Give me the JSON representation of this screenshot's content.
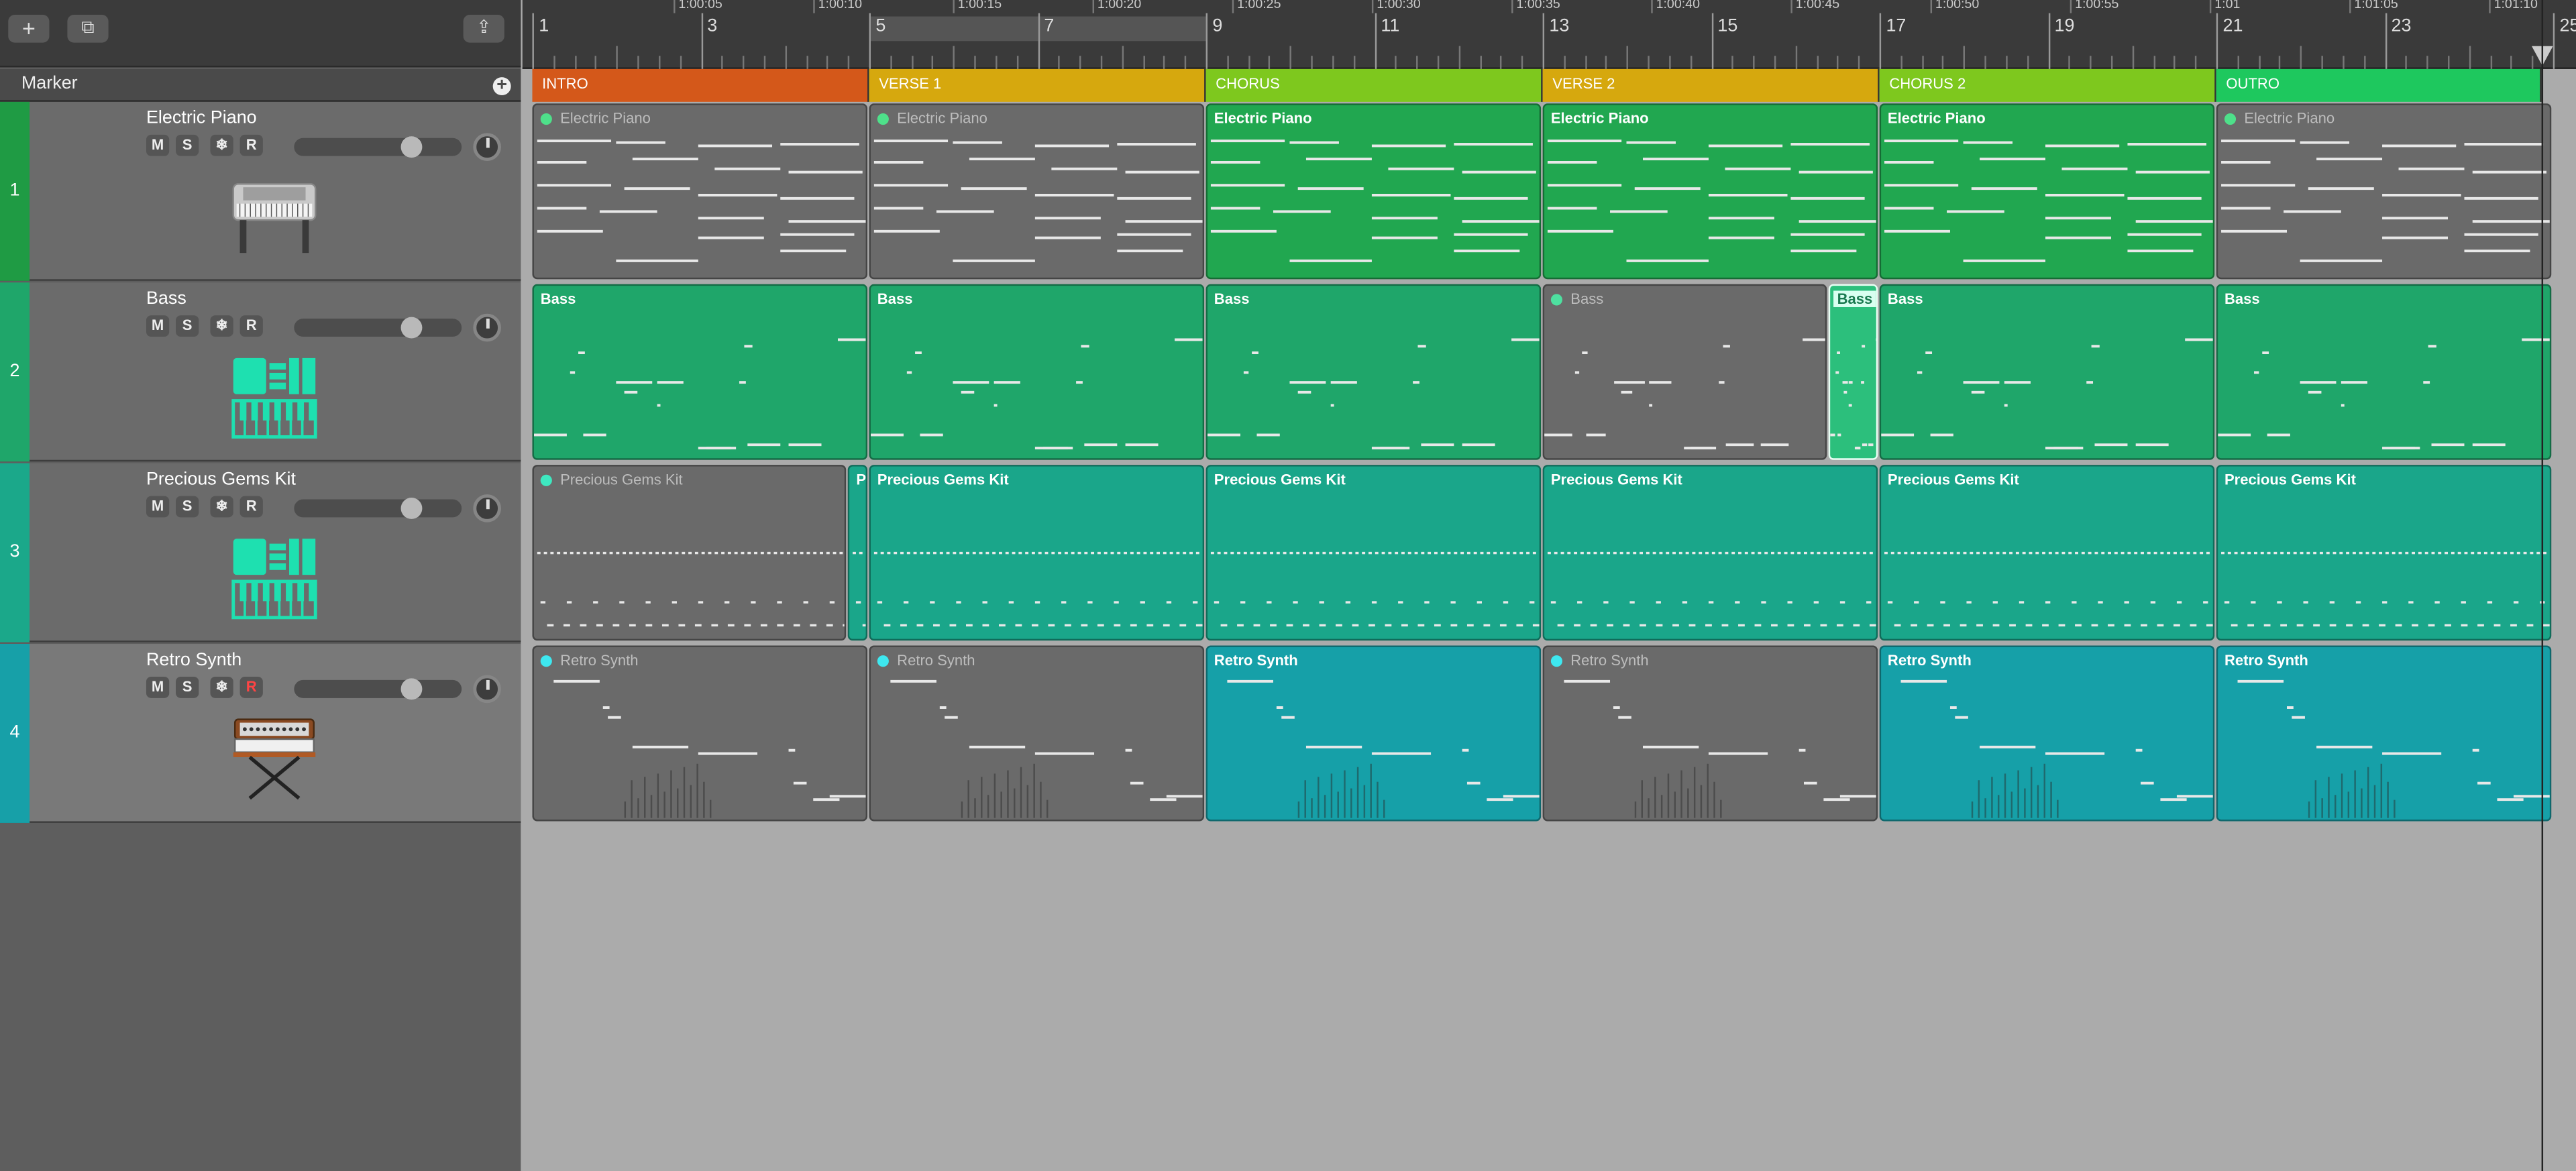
{
  "toolbar": {
    "add_label": "+",
    "dup_label": "⧉",
    "collapse_label": "⇪"
  },
  "marker_track": {
    "label": "Marker",
    "add": "+"
  },
  "ruler": {
    "bars": [
      "1",
      "3",
      "5",
      "7",
      "9",
      "11",
      "13",
      "15",
      "17",
      "19",
      "21",
      "23",
      "25"
    ],
    "times": [
      "1:00:05",
      "1:00:10",
      "1:00:15",
      "1:00:20",
      "1:00:25",
      "1:00:30",
      "1:00:35",
      "1:00:40",
      "1:00:45",
      "1:00:50",
      "1:00:55",
      "1:01",
      "1:01:05",
      "1:01:10"
    ]
  },
  "markers": [
    "INTRO",
    "VERSE 1",
    "CHORUS",
    "VERSE 2",
    "CHORUS 2",
    "OUTRO"
  ],
  "marker_colors": [
    "#d4581a",
    "#d6a80e",
    "#7ec81e",
    "#d6a80e",
    "#7ec81e",
    "#1ec85e"
  ],
  "tracks": [
    {
      "num": "1",
      "name": "Electric Piano",
      "mute": "M",
      "solo": "S",
      "freeze": "❄",
      "rec": "R",
      "color": "#1f9b44",
      "icon": "electric-piano-icon",
      "volume": 0.66
    },
    {
      "num": "2",
      "name": "Bass",
      "mute": "M",
      "solo": "S",
      "freeze": "❄",
      "rec": "R",
      "color": "#1fa66a",
      "icon": "drum-machine-icon",
      "volume": 0.66
    },
    {
      "num": "3",
      "name": "Precious Gems Kit",
      "mute": "M",
      "solo": "S",
      "freeze": "❄",
      "rec": "R",
      "color": "#1ba88a",
      "icon": "drum-machine-icon",
      "volume": 0.66
    },
    {
      "num": "4",
      "name": "Retro Synth",
      "mute": "M",
      "solo": "S",
      "freeze": "❄",
      "rec": "R",
      "color": "#17a0a8",
      "icon": "synthesizer-icon",
      "volume": 0.66
    }
  ],
  "regions": {
    "lane1": [
      {
        "name": "Electric Piano",
        "muted": true
      },
      {
        "name": "Electric Piano",
        "muted": true
      },
      {
        "name": "Electric Piano",
        "muted": false
      },
      {
        "name": "Electric Piano",
        "muted": false
      },
      {
        "name": "Electric Piano",
        "muted": false
      },
      {
        "name": "Electric Piano",
        "muted": true
      }
    ],
    "lane2": [
      {
        "name": "Bass",
        "muted": false
      },
      {
        "name": "Bass",
        "muted": false
      },
      {
        "name": "Bass",
        "muted": false
      },
      {
        "name": "Bass",
        "muted": true
      },
      {
        "name": "Bass",
        "muted": false,
        "selected": true
      },
      {
        "name": "Bass",
        "muted": false
      },
      {
        "name": "Bass",
        "muted": false
      }
    ],
    "lane3": [
      {
        "name": "Precious Gems Kit",
        "muted": true
      },
      {
        "name": "P",
        "muted": false
      },
      {
        "name": "Precious Gems Kit",
        "muted": false
      },
      {
        "name": "Precious Gems Kit",
        "muted": false
      },
      {
        "name": "Precious Gems Kit",
        "muted": false
      },
      {
        "name": "Precious Gems Kit",
        "muted": false
      },
      {
        "name": "Precious Gems Kit",
        "muted": false
      }
    ],
    "lane4": [
      {
        "name": "Retro Synth",
        "muted": true
      },
      {
        "name": "Retro Synth",
        "muted": true
      },
      {
        "name": "Retro Synth",
        "muted": false
      },
      {
        "name": "Retro Synth",
        "muted": true
      },
      {
        "name": "Retro Synth",
        "muted": false
      },
      {
        "name": "Retro Synth",
        "muted": false
      }
    ]
  }
}
